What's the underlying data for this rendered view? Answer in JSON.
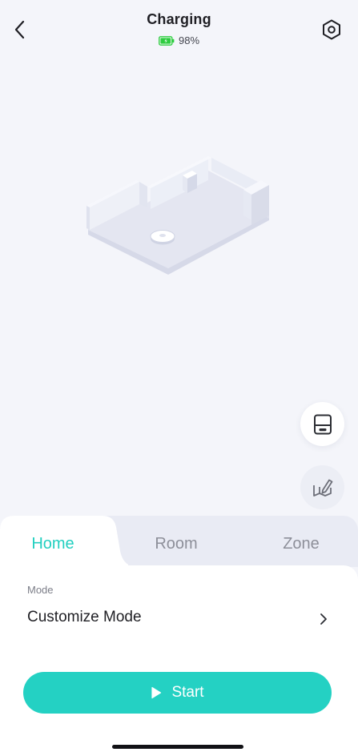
{
  "header": {
    "title": "Charging",
    "battery_percent": "98%",
    "back_icon": "chevron-left-icon",
    "settings_icon": "hexagon-gear-icon"
  },
  "map": {
    "description_icon": "isometric-room-map"
  },
  "actions": {
    "dock_icon": "dock-icon",
    "edit_map_icon": "map-edit-icon"
  },
  "tabs": [
    {
      "label": "Home",
      "active": true
    },
    {
      "label": "Room",
      "active": false
    },
    {
      "label": "Zone",
      "active": false
    }
  ],
  "mode": {
    "label": "Mode",
    "value": "Customize Mode"
  },
  "start_button": {
    "label": "Start"
  },
  "colors": {
    "accent": "#24d1c3",
    "tab_active": "#22cfc0",
    "battery": "#2ecc40",
    "background": "#f4f5fa"
  }
}
